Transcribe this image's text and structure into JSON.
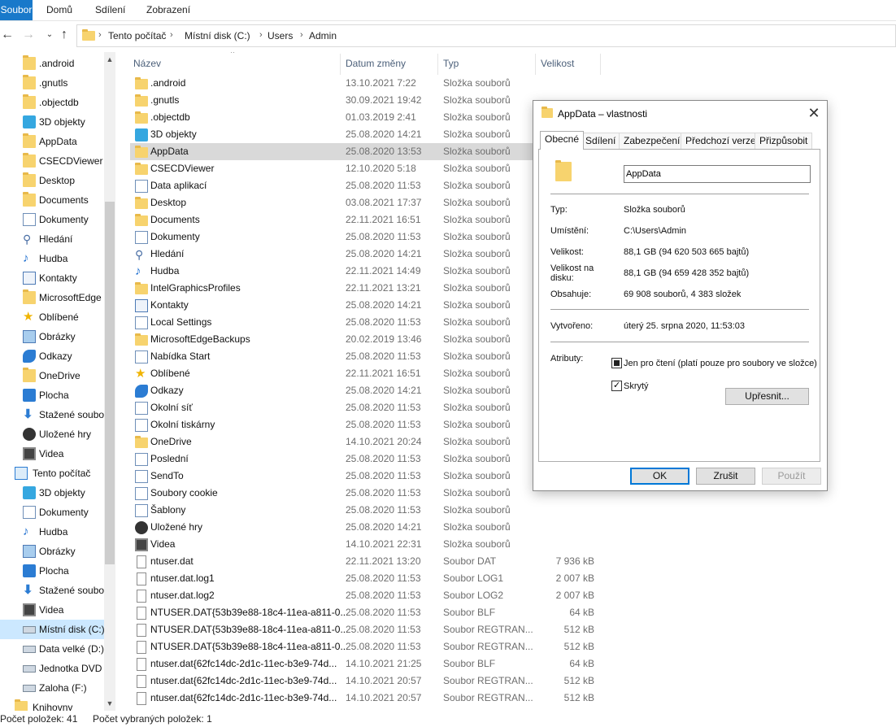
{
  "ribbon": {
    "tabs": [
      "Soubor",
      "Domů",
      "Sdílení",
      "Zobrazení"
    ]
  },
  "address": {
    "crumbs": [
      "Tento počítač",
      "Místní disk (C:)",
      "Users",
      "Admin"
    ]
  },
  "nav": {
    "items": [
      {
        "label": ".android",
        "icon": "folder-icon"
      },
      {
        "label": ".gnutls",
        "icon": "folder-icon"
      },
      {
        "label": ".objectdb",
        "icon": "folder-icon"
      },
      {
        "label": "3D objekty",
        "icon": "cube-icon"
      },
      {
        "label": "AppData",
        "icon": "folder-icon"
      },
      {
        "label": "CSECDViewer",
        "icon": "folder-icon"
      },
      {
        "label": "Desktop",
        "icon": "folder-icon"
      },
      {
        "label": "Documents",
        "icon": "folder-icon"
      },
      {
        "label": "Dokumenty",
        "icon": "document-icon"
      },
      {
        "label": "Hledání",
        "icon": "search-icon"
      },
      {
        "label": "Hudba",
        "icon": "music-icon"
      },
      {
        "label": "Kontakty",
        "icon": "contacts-icon"
      },
      {
        "label": "MicrosoftEdge",
        "icon": "folder-icon"
      },
      {
        "label": "Oblíbené",
        "icon": "star-icon"
      },
      {
        "label": "Obrázky",
        "icon": "pictures-icon"
      },
      {
        "label": "Odkazy",
        "icon": "link-icon"
      },
      {
        "label": "OneDrive",
        "icon": "folder-icon"
      },
      {
        "label": "Plocha",
        "icon": "desktop-icon"
      },
      {
        "label": "Stažené soubo",
        "icon": "download-icon"
      },
      {
        "label": "Uložené hry",
        "icon": "game-icon"
      },
      {
        "label": "Videa",
        "icon": "video-icon"
      },
      {
        "label": "Tento počítač",
        "icon": "computer-icon"
      },
      {
        "label": "3D objekty",
        "icon": "cube-icon"
      },
      {
        "label": "Dokumenty",
        "icon": "document-icon"
      },
      {
        "label": "Hudba",
        "icon": "music-icon"
      },
      {
        "label": "Obrázky",
        "icon": "pictures-icon"
      },
      {
        "label": "Plocha",
        "icon": "desktop-icon"
      },
      {
        "label": "Stažené soubo",
        "icon": "download-icon"
      },
      {
        "label": "Videa",
        "icon": "video-icon"
      },
      {
        "label": "Místní disk (C:)",
        "icon": "drive-icon"
      },
      {
        "label": "Data velké (D:)",
        "icon": "drive-icon"
      },
      {
        "label": "Jednotka DVD I",
        "icon": "dvd-icon"
      },
      {
        "label": "Zaloha (F:)",
        "icon": "drive-icon"
      },
      {
        "label": "Knihovny",
        "icon": "library-icon"
      }
    ]
  },
  "columns": {
    "name": "Název",
    "date": "Datum změny",
    "type": "Typ",
    "size": "Velikost"
  },
  "files": [
    {
      "name": ".android",
      "date": "13.10.2021 7:22",
      "type": "Složka souborů",
      "size": "",
      "icon": "folder-icon"
    },
    {
      "name": ".gnutls",
      "date": "30.09.2021 19:42",
      "type": "Složka souborů",
      "size": "",
      "icon": "folder-icon"
    },
    {
      "name": ".objectdb",
      "date": "01.03.2019 2:41",
      "type": "Složka souborů",
      "size": "",
      "icon": "folder-icon"
    },
    {
      "name": "3D objekty",
      "date": "25.08.2020 14:21",
      "type": "Složka souborů",
      "size": "",
      "icon": "cube-icon"
    },
    {
      "name": "AppData",
      "date": "25.08.2020 13:53",
      "type": "Složka souborů",
      "size": "",
      "icon": "folder-icon"
    },
    {
      "name": "CSECDViewer",
      "date": "12.10.2020 5:18",
      "type": "Složka souborů",
      "size": "",
      "icon": "folder-icon"
    },
    {
      "name": "Data aplikací",
      "date": "25.08.2020 11:53",
      "type": "Složka souborů",
      "size": "",
      "icon": "shortcut-icon"
    },
    {
      "name": "Desktop",
      "date": "03.08.2021 17:37",
      "type": "Složka souborů",
      "size": "",
      "icon": "folder-icon"
    },
    {
      "name": "Documents",
      "date": "22.11.2021 16:51",
      "type": "Složka souborů",
      "size": "",
      "icon": "folder-icon"
    },
    {
      "name": "Dokumenty",
      "date": "25.08.2020 11:53",
      "type": "Složka souborů",
      "size": "",
      "icon": "shortcut-icon"
    },
    {
      "name": "Hledání",
      "date": "25.08.2020 14:21",
      "type": "Složka souborů",
      "size": "",
      "icon": "search-icon"
    },
    {
      "name": "Hudba",
      "date": "22.11.2021 14:49",
      "type": "Složka souborů",
      "size": "",
      "icon": "music-icon"
    },
    {
      "name": "IntelGraphicsProfiles",
      "date": "22.11.2021 13:21",
      "type": "Složka souborů",
      "size": "",
      "icon": "folder-icon"
    },
    {
      "name": "Kontakty",
      "date": "25.08.2020 14:21",
      "type": "Složka souborů",
      "size": "",
      "icon": "contacts-icon"
    },
    {
      "name": "Local Settings",
      "date": "25.08.2020 11:53",
      "type": "Složka souborů",
      "size": "",
      "icon": "shortcut-icon"
    },
    {
      "name": "MicrosoftEdgeBackups",
      "date": "20.02.2019 13:46",
      "type": "Složka souborů",
      "size": "",
      "icon": "folder-icon"
    },
    {
      "name": "Nabídka Start",
      "date": "25.08.2020 11:53",
      "type": "Složka souborů",
      "size": "",
      "icon": "shortcut-icon"
    },
    {
      "name": "Oblíbené",
      "date": "22.11.2021 16:51",
      "type": "Složka souborů",
      "size": "",
      "icon": "star-icon"
    },
    {
      "name": "Odkazy",
      "date": "25.08.2020 14:21",
      "type": "Složka souborů",
      "size": "",
      "icon": "link-icon"
    },
    {
      "name": "Okolní síť",
      "date": "25.08.2020 11:53",
      "type": "Složka souborů",
      "size": "",
      "icon": "shortcut-icon"
    },
    {
      "name": "Okolní tiskárny",
      "date": "25.08.2020 11:53",
      "type": "Složka souborů",
      "size": "",
      "icon": "shortcut-icon"
    },
    {
      "name": "OneDrive",
      "date": "14.10.2021 20:24",
      "type": "Složka souborů",
      "size": "",
      "icon": "folder-icon"
    },
    {
      "name": "Poslední",
      "date": "25.08.2020 11:53",
      "type": "Složka souborů",
      "size": "",
      "icon": "shortcut-icon"
    },
    {
      "name": "SendTo",
      "date": "25.08.2020 11:53",
      "type": "Složka souborů",
      "size": "",
      "icon": "shortcut-icon"
    },
    {
      "name": "Soubory cookie",
      "date": "25.08.2020 11:53",
      "type": "Složka souborů",
      "size": "",
      "icon": "shortcut-icon"
    },
    {
      "name": "Šablony",
      "date": "25.08.2020 11:53",
      "type": "Složka souborů",
      "size": "",
      "icon": "shortcut-icon"
    },
    {
      "name": "Uložené hry",
      "date": "25.08.2020 14:21",
      "type": "Složka souborů",
      "size": "",
      "icon": "game-icon"
    },
    {
      "name": "Videa",
      "date": "14.10.2021 22:31",
      "type": "Složka souborů",
      "size": "",
      "icon": "video-icon"
    },
    {
      "name": "ntuser.dat",
      "date": "22.11.2021 13:20",
      "type": "Soubor DAT",
      "size": "7 936 kB",
      "icon": "file-icon"
    },
    {
      "name": "ntuser.dat.log1",
      "date": "25.08.2020 11:53",
      "type": "Soubor LOG1",
      "size": "2 007 kB",
      "icon": "file-icon"
    },
    {
      "name": "ntuser.dat.log2",
      "date": "25.08.2020 11:53",
      "type": "Soubor LOG2",
      "size": "2 007 kB",
      "icon": "file-icon"
    },
    {
      "name": "NTUSER.DAT{53b39e88-18c4-11ea-a811-0...",
      "date": "25.08.2020 11:53",
      "type": "Soubor BLF",
      "size": "64 kB",
      "icon": "file-icon"
    },
    {
      "name": "NTUSER.DAT{53b39e88-18c4-11ea-a811-0...",
      "date": "25.08.2020 11:53",
      "type": "Soubor REGTRAN...",
      "size": "512 kB",
      "icon": "file-icon"
    },
    {
      "name": "NTUSER.DAT{53b39e88-18c4-11ea-a811-0...",
      "date": "25.08.2020 11:53",
      "type": "Soubor REGTRAN...",
      "size": "512 kB",
      "icon": "file-icon"
    },
    {
      "name": "ntuser.dat{62fc14dc-2d1c-11ec-b3e9-74d...",
      "date": "14.10.2021 21:25",
      "type": "Soubor BLF",
      "size": "64 kB",
      "icon": "file-icon"
    },
    {
      "name": "ntuser.dat{62fc14dc-2d1c-11ec-b3e9-74d...",
      "date": "14.10.2021 20:57",
      "type": "Soubor REGTRAN...",
      "size": "512 kB",
      "icon": "file-icon"
    },
    {
      "name": "ntuser.dat{62fc14dc-2d1c-11ec-b3e9-74d...",
      "date": "14.10.2021 20:57",
      "type": "Soubor REGTRAN...",
      "size": "512 kB",
      "icon": "file-icon"
    }
  ],
  "status": {
    "count": "Počet položek: 41",
    "selected": "Počet vybraných položek: 1"
  },
  "dialog": {
    "title": "AppData – vlastnosti",
    "tabs": [
      "Obecné",
      "Sdílení",
      "Zabezpečení",
      "Předchozí verze",
      "Přizpůsobit"
    ],
    "name_value": "AppData",
    "props": {
      "type_label": "Typ:",
      "type_value": "Složka souborů",
      "location_label": "Umístění:",
      "location_value": "C:\\Users\\Admin",
      "size_label": "Velikost:",
      "size_value": "88,1 GB (94 620 503 665 bajtů)",
      "disksize_label": "Velikost na disku:",
      "disksize_value": "88,1 GB (94 659 428 352 bajtů)",
      "contains_label": "Obsahuje:",
      "contains_value": "69 908 souborů, 4 383 složek",
      "created_label": "Vytvořeno:",
      "created_value": "úterý 25. srpna 2020, 11:53:03",
      "attributes_label": "Atributy:",
      "readonly_label": "Jen pro čtení (platí pouze pro soubory ve složce)",
      "hidden_label": "Skrytý",
      "advanced_label": "Upřesnit..."
    },
    "buttons": {
      "ok": "OK",
      "cancel": "Zrušit",
      "apply": "Použít"
    }
  }
}
